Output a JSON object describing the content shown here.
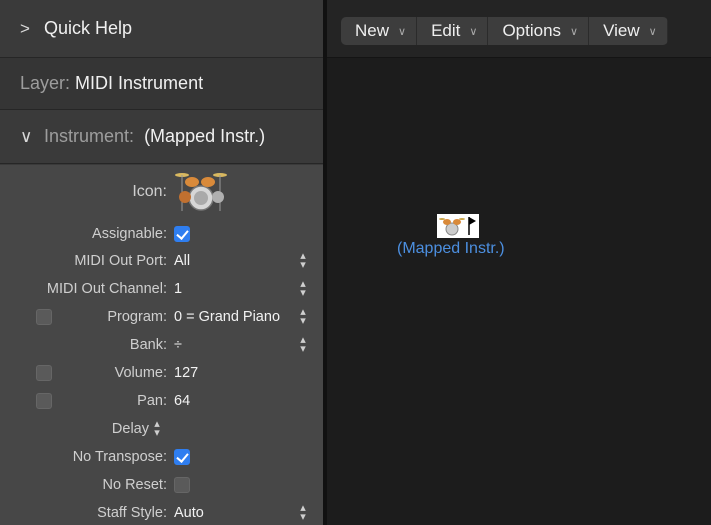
{
  "inspector": {
    "quick_help": {
      "chevron": ">",
      "label": "Quick Help"
    },
    "layer": {
      "prefix": "Layer:",
      "value": "MIDI Instrument"
    },
    "instrument": {
      "chevron": "∨",
      "prefix": "Instrument:",
      "value": "(Mapped Instr.)"
    },
    "icon_label": "Icon:",
    "icon_name": "drum-kit-icon",
    "params": {
      "assignable": {
        "label": "Assignable:",
        "checked": true
      },
      "midi_out_port": {
        "label": "MIDI Out Port:",
        "value": "All"
      },
      "midi_out_channel": {
        "label": "MIDI Out Channel:",
        "value": "1"
      },
      "program": {
        "label": "Program:",
        "value": "0 = Grand Piano",
        "enabled": false
      },
      "bank": {
        "label": "Bank:",
        "value": "÷"
      },
      "volume": {
        "label": "Volume:",
        "value": "127",
        "enabled": false
      },
      "pan": {
        "label": "Pan:",
        "value": "64",
        "enabled": false
      },
      "delay": {
        "label": "Delay"
      },
      "no_transpose": {
        "label": "No Transpose:",
        "checked": true
      },
      "no_reset": {
        "label": "No Reset:",
        "checked": false
      },
      "staff_style": {
        "label": "Staff Style:",
        "value": "Auto"
      }
    }
  },
  "environment": {
    "menus": [
      {
        "label": "New"
      },
      {
        "label": "Edit"
      },
      {
        "label": "Options"
      },
      {
        "label": "View"
      }
    ],
    "object": {
      "label": "(Mapped Instr.)",
      "icon_name": "drum-kit-icon"
    }
  },
  "colors": {
    "accent": "#2f7ef0",
    "object_label": "#4c8fe0",
    "panel": "#474747"
  }
}
